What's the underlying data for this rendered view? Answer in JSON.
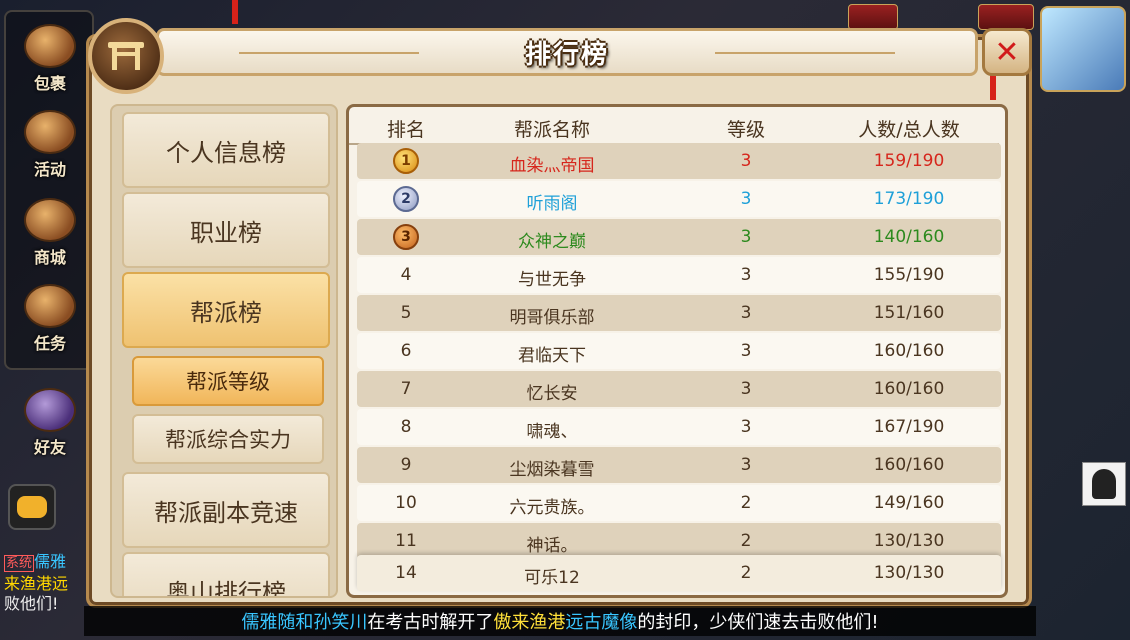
{
  "window": {
    "title": "排行榜"
  },
  "sidebar": {
    "items": [
      {
        "label": "包裹",
        "icon": "bag-icon"
      },
      {
        "label": "活动",
        "icon": "horn-icon"
      },
      {
        "label": "商城",
        "icon": "shop-icon"
      },
      {
        "label": "任务",
        "icon": "scroll-icon"
      },
      {
        "label": "好友",
        "icon": "friend-hat-icon"
      }
    ]
  },
  "chat": {
    "lines": [
      {
        "prefix": "系统",
        "text": "儒雅"
      },
      {
        "text": "来渔港远"
      },
      {
        "text": "败他们!"
      }
    ]
  },
  "menu": {
    "items": [
      {
        "label": "个人信息榜"
      },
      {
        "label": "职业榜"
      },
      {
        "label": "帮派榜"
      },
      {
        "label": "帮派等级"
      },
      {
        "label": "帮派综合实力"
      },
      {
        "label": "帮派副本竞速"
      },
      {
        "label": "奥山排行榜"
      }
    ],
    "active_main": "帮派榜",
    "active_sub": "帮派等级"
  },
  "table": {
    "headers": {
      "rank": "排名",
      "name": "帮派名称",
      "level": "等级",
      "members": "人数/总人数"
    },
    "rows": [
      {
        "rank": "1",
        "name": "血染灬帝国",
        "level": "3",
        "members": "159/190",
        "color": "#d6261c"
      },
      {
        "rank": "2",
        "name": "听雨阁",
        "level": "3",
        "members": "173/190",
        "color": "#1ea0d8"
      },
      {
        "rank": "3",
        "name": "众神之巅",
        "level": "3",
        "members": "140/160",
        "color": "#2d8a1e"
      },
      {
        "rank": "4",
        "name": "与世无争",
        "level": "3",
        "members": "155/190"
      },
      {
        "rank": "5",
        "name": "明哥俱乐部",
        "level": "3",
        "members": "151/160"
      },
      {
        "rank": "6",
        "name": "君临天下",
        "level": "3",
        "members": "160/160"
      },
      {
        "rank": "7",
        "name": "忆长安",
        "level": "3",
        "members": "160/160"
      },
      {
        "rank": "8",
        "name": "啸魂、",
        "level": "3",
        "members": "167/190"
      },
      {
        "rank": "9",
        "name": "尘烟染暮雪",
        "level": "3",
        "members": "160/160"
      },
      {
        "rank": "10",
        "name": "六元贵族。",
        "level": "2",
        "members": "149/160"
      },
      {
        "rank": "11",
        "name": "神话。",
        "level": "2",
        "members": "130/130"
      }
    ],
    "own_row": {
      "rank": "14",
      "name": "可乐12",
      "level": "2",
      "members": "130/130"
    }
  },
  "announcement": {
    "part1": "儒雅随和孙笑川",
    "part2": "在考古时解开了",
    "part3": "傲来渔港",
    "part4": "远古魔像",
    "part5": "的封印，少侠们速去击败他们!"
  },
  "colors": {
    "rank1": "#d6261c",
    "rank2": "#1ea0d8",
    "rank3": "#2d8a1e",
    "text": "#4a3520"
  }
}
